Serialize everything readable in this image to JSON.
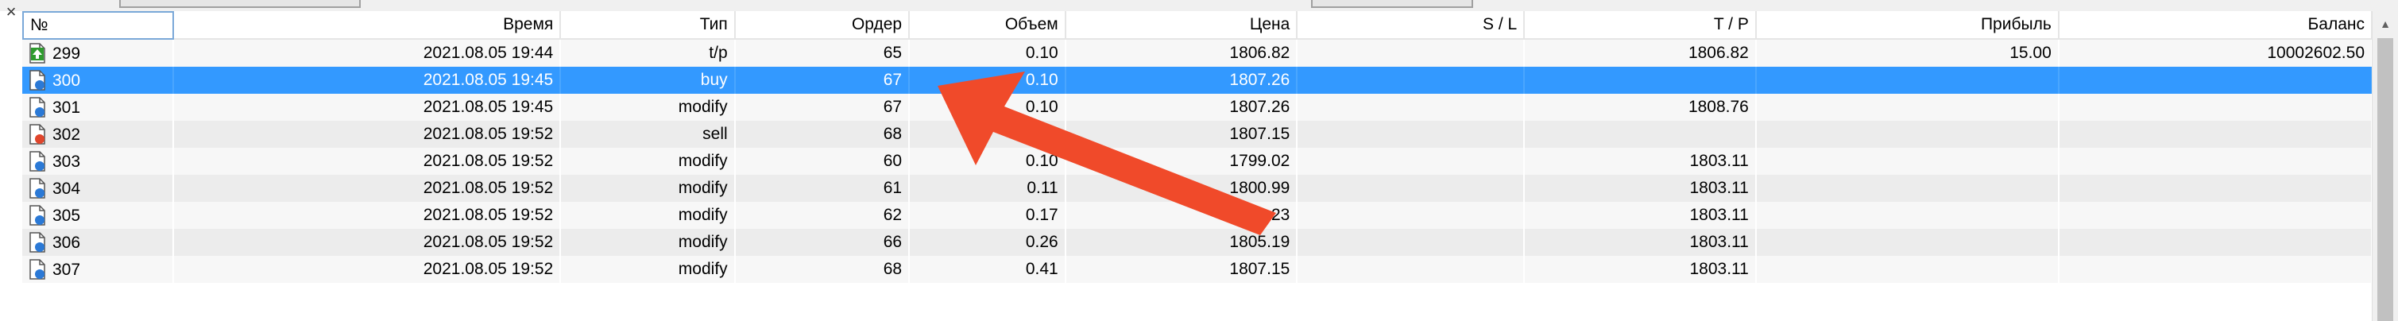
{
  "columns": {
    "num": "№",
    "time": "Время",
    "type": "Тип",
    "order": "Ордер",
    "volume": "Объем",
    "price": "Цена",
    "sl": "S / L",
    "tp": "T / P",
    "profit": "Прибыль",
    "balance": "Баланс"
  },
  "rows": [
    {
      "num": "299",
      "time": "2021.08.05 19:44",
      "type": "t/p",
      "order": "65",
      "volume": "0.10",
      "price": "1806.82",
      "sl": "",
      "tp": "1806.82",
      "profit": "15.00",
      "balance": "10002602.50",
      "icon": "tp-doc-icon"
    },
    {
      "num": "300",
      "time": "2021.08.05 19:45",
      "type": "buy",
      "order": "67",
      "volume": "0.10",
      "price": "1807.26",
      "sl": "",
      "tp": "",
      "profit": "",
      "balance": "",
      "icon": "buy-doc-icon"
    },
    {
      "num": "301",
      "time": "2021.08.05 19:45",
      "type": "modify",
      "order": "67",
      "volume": "0.10",
      "price": "1807.26",
      "sl": "",
      "tp": "1808.76",
      "profit": "",
      "balance": "",
      "icon": "modify-doc-icon"
    },
    {
      "num": "302",
      "time": "2021.08.05 19:52",
      "type": "sell",
      "order": "68",
      "volume": "",
      "price": "1807.15",
      "sl": "",
      "tp": "",
      "profit": "",
      "balance": "",
      "icon": "sell-doc-icon"
    },
    {
      "num": "303",
      "time": "2021.08.05 19:52",
      "type": "modify",
      "order": "60",
      "volume": "0.10",
      "price": "1799.02",
      "sl": "",
      "tp": "1803.11",
      "profit": "",
      "balance": "",
      "icon": "modify-doc-icon"
    },
    {
      "num": "304",
      "time": "2021.08.05 19:52",
      "type": "modify",
      "order": "61",
      "volume": "0.11",
      "price": "1800.99",
      "sl": "",
      "tp": "1803.11",
      "profit": "",
      "balance": "",
      "icon": "modify-doc-icon"
    },
    {
      "num": "305",
      "time": "2021.08.05 19:52",
      "type": "modify",
      "order": "62",
      "volume": "0.17",
      "price": "1803.23",
      "sl": "",
      "tp": "1803.11",
      "profit": "",
      "balance": "",
      "icon": "modify-doc-icon"
    },
    {
      "num": "306",
      "time": "2021.08.05 19:52",
      "type": "modify",
      "order": "66",
      "volume": "0.26",
      "price": "1805.19",
      "sl": "",
      "tp": "1803.11",
      "profit": "",
      "balance": "",
      "icon": "modify-doc-icon"
    },
    {
      "num": "307",
      "time": "2021.08.05 19:52",
      "type": "modify",
      "order": "68",
      "volume": "0.41",
      "price": "1807.15",
      "sl": "",
      "tp": "1803.11",
      "profit": "",
      "balance": "",
      "icon": "modify-doc-icon"
    }
  ],
  "selected_row": 1,
  "colors": {
    "selection": "#3399ff",
    "arrow": "#f04a2a",
    "header_border": "#7aa8d8"
  },
  "icons": {
    "close": "×",
    "scroll_up": "▲"
  }
}
